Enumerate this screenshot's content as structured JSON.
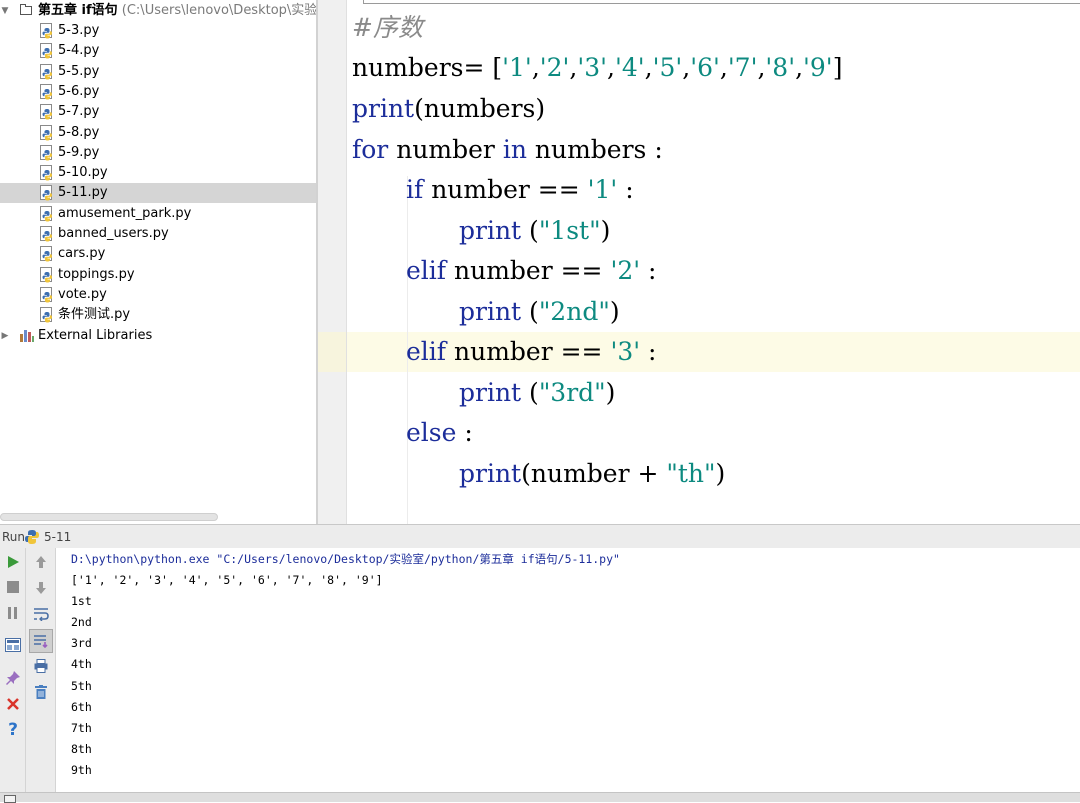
{
  "project_tree": {
    "root": {
      "label": "第五章 if语句",
      "path": "(C:\\Users\\lenovo\\Desktop\\实验室"
    },
    "files": [
      {
        "name": "5-3.py"
      },
      {
        "name": "5-4.py"
      },
      {
        "name": "5-5.py"
      },
      {
        "name": "5-6.py"
      },
      {
        "name": "5-7.py"
      },
      {
        "name": "5-8.py"
      },
      {
        "name": "5-9.py"
      },
      {
        "name": "5-10.py"
      },
      {
        "name": "5-11.py",
        "selected": true
      },
      {
        "name": "amusement_park.py"
      },
      {
        "name": "banned_users.py"
      },
      {
        "name": "cars.py"
      },
      {
        "name": "toppings.py"
      },
      {
        "name": "vote.py"
      },
      {
        "name": "条件测试.py"
      }
    ],
    "external_libraries": "External Libraries"
  },
  "editor": {
    "line1": {
      "comment": "#序数"
    },
    "line2": {
      "var": "numbers",
      "op": "= [",
      "s1": "'1'",
      "s2": "'2'",
      "s3": "'3'",
      "s4": "'4'",
      "s5": "'5'",
      "s6": "'6'",
      "s7": "'7'",
      "s8": "'8'",
      "s9": "'9'",
      "comma": ",",
      "close": "]"
    },
    "line3": {
      "fn": "print",
      "rest": "(numbers)"
    },
    "line4": {
      "kw_for": "for",
      "var": " number ",
      "kw_in": "in",
      "rest": " numbers :"
    },
    "line5": {
      "kw": "if",
      "rest": " number == ",
      "str": "'1'",
      "tail": " :"
    },
    "line6": {
      "fn": "print",
      "rest": " (",
      "str": "\"1st\"",
      "tail": ")"
    },
    "line7": {
      "kw": "elif",
      "rest": " number == ",
      "str": "'2'",
      "tail": " :"
    },
    "line8": {
      "fn": "print",
      "rest": " (",
      "str": "\"2nd\"",
      "tail": ")"
    },
    "line9": {
      "kw": "elif",
      "rest": " number == ",
      "str": "'3'",
      "tail": " :"
    },
    "line10": {
      "fn": "print",
      "rest": " (",
      "str": "\"3rd\"",
      "tail": ")"
    },
    "line11": {
      "kw": "else",
      "rest": " :"
    },
    "line12": {
      "fn": "print",
      "rest": "(number + ",
      "str": "\"th\"",
      "tail": ")"
    }
  },
  "run_panel": {
    "title": "Run",
    "tab_name": "5-11",
    "console": {
      "command": "D:\\python\\python.exe \"C:/Users/lenovo/Desktop/实验室/python/第五章 if语句/5-11.py\"",
      "lines": [
        "['1', '2', '3', '4', '5', '6', '7', '8', '9']",
        "1st",
        "2nd",
        "3rd",
        "4th",
        "5th",
        "6th",
        "7th",
        "8th",
        "9th"
      ]
    },
    "toolbar_icons": [
      "run-icon",
      "stop-icon",
      "pause-icon",
      "layout-icon",
      "pin-icon",
      "close-icon",
      "help-icon",
      "up-arrow-icon",
      "down-arrow-icon",
      "soft-wrap-icon",
      "scroll-to-end-icon",
      "print-icon",
      "trash-icon"
    ]
  },
  "colors": {
    "keyword": "#1c2d9a",
    "string": "#0d8a80",
    "comment": "#8a8a8a",
    "selection": "#d5d5d5",
    "current_line": "#fdfbe6",
    "run_green": "#3a9a3a",
    "close_red": "#d9342b",
    "help_blue": "#2d74c9"
  }
}
